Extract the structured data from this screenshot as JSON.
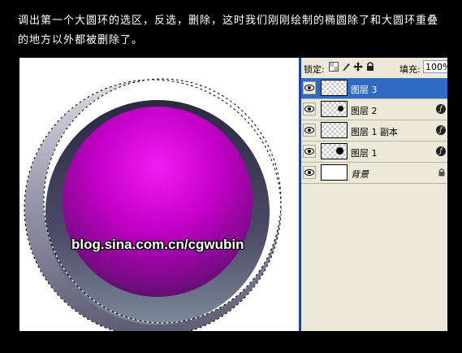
{
  "caption": {
    "line1": "调出第一个大圆环的选区，反选，删除，这时我们刚刚绘制的椭圆除了和大圆环重叠",
    "line2": "的地方以外都被删除了。"
  },
  "canvas": {
    "watermark": "blog.sina.com.cn/cgwubin"
  },
  "layers_panel": {
    "lock_label": "锁定:",
    "lock_icons": [
      "transparency-lock-icon",
      "brush-lock-icon",
      "move-lock-icon",
      "padlock-icon"
    ],
    "fill_label": "填充:",
    "fill_value": "100%",
    "layers": [
      {
        "name": "图层 3",
        "selected": true,
        "thumb": "transparent",
        "fx": false,
        "locked": false
      },
      {
        "name": "图层 2",
        "selected": false,
        "thumb": "transparent-dot",
        "fx": true,
        "locked": false
      },
      {
        "name": "图层 1 副本",
        "selected": false,
        "thumb": "transparent",
        "fx": true,
        "locked": false
      },
      {
        "name": "图层 1",
        "selected": false,
        "thumb": "transparent-dot",
        "fx": true,
        "locked": false
      },
      {
        "name": "背景",
        "selected": false,
        "thumb": "white",
        "fx": false,
        "locked": true
      }
    ]
  },
  "colors": {
    "selection_accent": "#316ac5",
    "panel_bg": "#ece9d8",
    "magenta": "#d400d4"
  }
}
